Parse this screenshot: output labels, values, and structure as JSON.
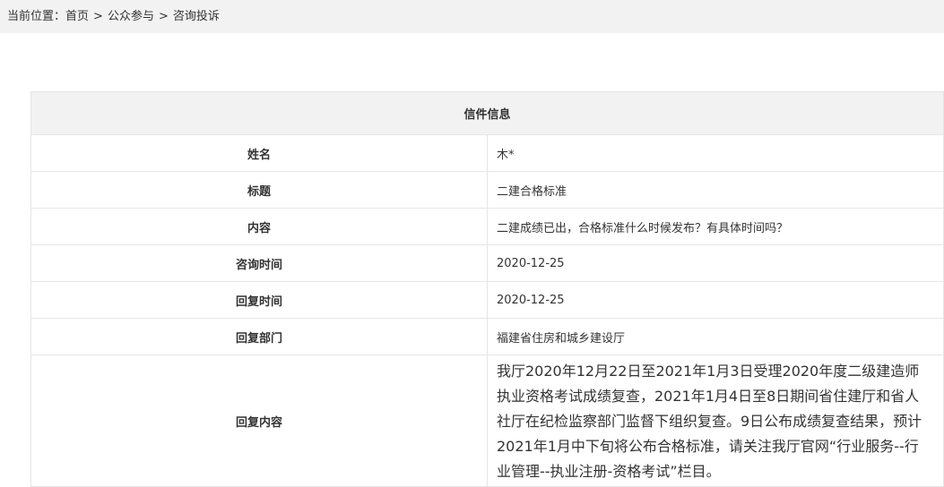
{
  "breadcrumb": {
    "prefix": "当前位置：",
    "items": [
      "首页",
      "公众参与",
      "咨询投诉"
    ],
    "separator": ">"
  },
  "letter": {
    "header": "信件信息",
    "rows": [
      {
        "label": "姓名",
        "value": "木*"
      },
      {
        "label": "标题",
        "value": "二建合格标准"
      },
      {
        "label": "内容",
        "value": "二建成绩已出，合格标准什么时候发布？有具体时间吗？"
      },
      {
        "label": "咨询时间",
        "value": "2020-12-25"
      },
      {
        "label": "回复时间",
        "value": "2020-12-25"
      },
      {
        "label": "回复部门",
        "value": "福建省住房和城乡建设厅"
      },
      {
        "label": "回复内容",
        "value": "我厅2020年12月22日至2021年1月3日受理2020年度二级建造师执业资格考试成绩复查，2021年1月4日至8日期间省住建厅和省人社厅在纪检监察部门监督下组织复查。9日公布成绩复查结果，预计2021年1月中下旬将公布合格标准，请关注我厅官网“行业服务--行业管理--执业注册-资格考试”栏目。"
      }
    ]
  }
}
